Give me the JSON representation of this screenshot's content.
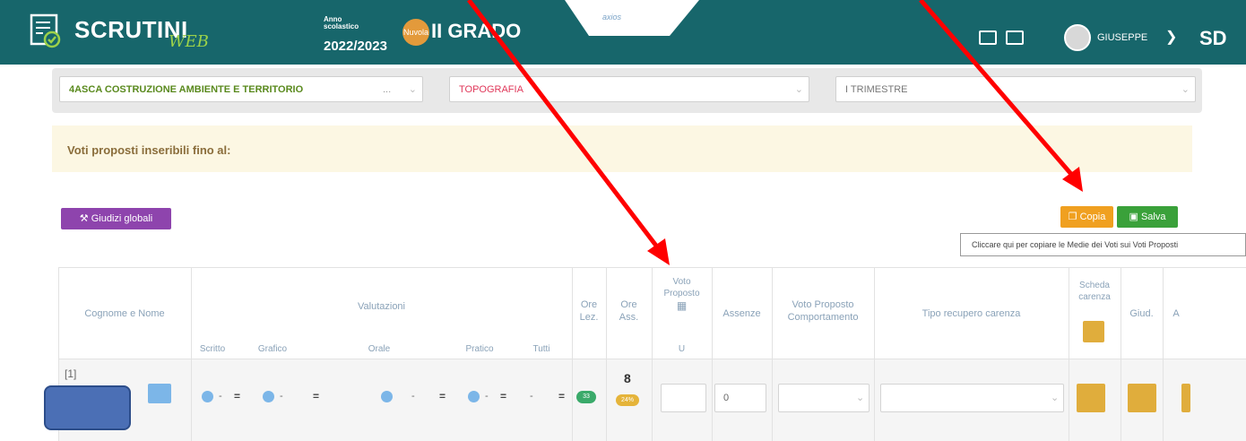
{
  "header": {
    "app_title": "SCRUTINI",
    "app_subtitle": "WEB",
    "year_label": "Anno scolastico",
    "year_value": "2022/2023",
    "badge_text": "Nuvola",
    "grade": "II GRADO",
    "tab_text": "axios",
    "user_name": "GIUSEPPE",
    "initials": "SD"
  },
  "filters": {
    "class": "4ASCA COSTRUZIONE AMBIENTE E TERRITORIO",
    "class_ellipsis": "...",
    "subject": "TOPOGRAFIA",
    "period": "I TRIMESTRE"
  },
  "notice": {
    "text": "Voti proposti inseribili fino al:"
  },
  "buttons": {
    "giudizi": "Giudizi globali",
    "copia": "Copia",
    "salva": "Salva",
    "tooltip": "Cliccare qui per copiare le Medie dei Voti sui Voti Proposti"
  },
  "table": {
    "headers": {
      "name": "Cognome e Nome",
      "valutazioni": "Valutazioni",
      "scritto": "Scritto",
      "grafico": "Grafico",
      "orale": "Orale",
      "pratico": "Pratico",
      "tutti": "Tutti",
      "ore_lez_1": "Ore",
      "ore_lez_2": "Lez.",
      "ore_ass_1": "Ore",
      "ore_ass_2": "Ass.",
      "voto_prop_1": "Voto",
      "voto_prop_2": "Proposto",
      "voto_prop_unit": "U",
      "assenze": "Assenze",
      "comportamento_1": "Voto Proposto",
      "comportamento_2": "Comportamento",
      "recupero": "Tipo recupero carenza",
      "scheda_1": "Scheda",
      "scheda_2": "carenza",
      "giud": "Giud.",
      "a": "A"
    },
    "row": {
      "index": "[1]",
      "dash": "-",
      "eq": "=",
      "ore_lez_pill": "33",
      "ore_ass": "8",
      "ore_ass_pct": "24%",
      "assenze": "0"
    }
  },
  "colors": {
    "header_bg": "#17666b",
    "copia": "#f0a020",
    "salva": "#3aa13a",
    "giudizi": "#8e44ad",
    "arrow": "#ff0000"
  }
}
